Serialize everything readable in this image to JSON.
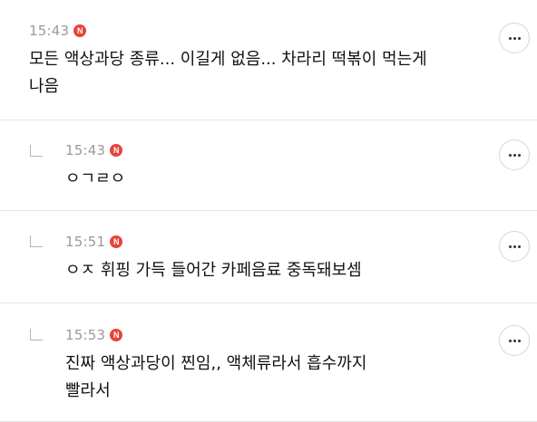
{
  "comments": [
    {
      "time": "15:43",
      "badge": "N",
      "text": "모든 액상과당 종류... 이길게 없음... 차라리 떡볶이 먹는게\n나음",
      "is_reply": false
    },
    {
      "time": "15:43",
      "badge": "N",
      "text": "ㅇㄱㄹㅇ",
      "is_reply": true
    },
    {
      "time": "15:51",
      "badge": "N",
      "text": "ㅇㅈ 휘핑 가득 들어간 카페음료 중독돼보셈",
      "is_reply": true
    },
    {
      "time": "15:53",
      "badge": "N",
      "text": "진짜 액상과당이 찐임,, 액체류라서 흡수까지\n빨라서",
      "is_reply": true
    }
  ],
  "icons": {
    "reply": "reply-arrow-icon",
    "more": "more-dots-icon",
    "new": "new-badge-icon"
  },
  "colors": {
    "badge": "#e8443a",
    "meta_text": "#9a9a9a",
    "divider": "#e4e4e4"
  }
}
